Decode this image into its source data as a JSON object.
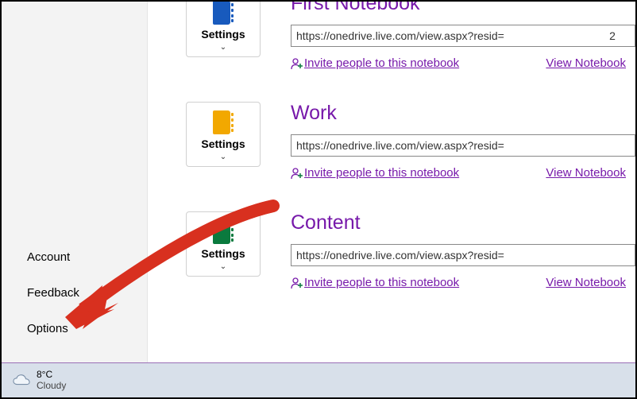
{
  "sidebar": {
    "items": [
      {
        "label": "Account"
      },
      {
        "label": "Feedback"
      },
      {
        "label": "Options"
      }
    ]
  },
  "notebooks": [
    {
      "title": "First Notebook",
      "url": "https://onedrive.live.com/view.aspx?resid=                                  2",
      "color": "blue",
      "settings_label": "Settings",
      "invite_label": "Invite people to this notebook",
      "view_label": "View Notebook"
    },
    {
      "title": "Work",
      "url": "https://onedrive.live.com/view.aspx?resid=",
      "color": "yellow",
      "settings_label": "Settings",
      "invite_label": "Invite people to this notebook",
      "view_label": "View Notebook"
    },
    {
      "title": "Content",
      "url": "https://onedrive.live.com/view.aspx?resid=",
      "color": "green",
      "settings_label": "Settings",
      "invite_label": "Invite people to this notebook",
      "view_label": "View Notebook"
    }
  ],
  "taskbar": {
    "temperature": "8°C",
    "condition": "Cloudy"
  }
}
